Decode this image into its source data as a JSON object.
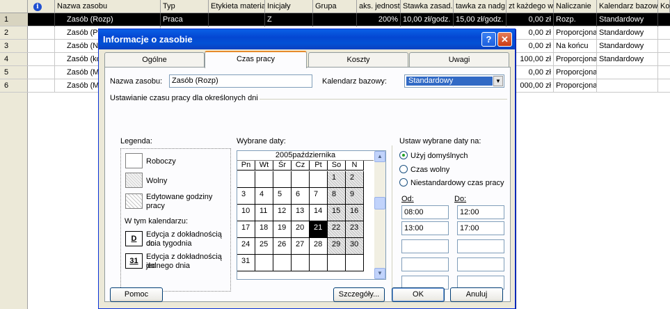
{
  "sheet": {
    "columns": [
      "",
      "",
      "Nazwa zasobu",
      "Typ",
      "Etykieta materia",
      "Inicjały",
      "Grupa",
      "aks. jednost",
      "Stawka zasad.",
      "tawka za nadg",
      "zt każdego w",
      "Naliczanie",
      "Kalendarz bazow",
      "Koo"
    ],
    "rows": [
      {
        "num": "1",
        "name": "Zasób (Rozp)",
        "type": "Praca",
        "initials": "Z",
        "units": "200%",
        "rate": "10,00 zł/godz.",
        "ovt": "15,00 zł/godz.",
        "cost": "0,00 zł",
        "accrue": "Rozp.",
        "calendar": "Standardowy"
      },
      {
        "num": "2",
        "name": "Zasób (Pr",
        "type": "",
        "initials": "",
        "units": "",
        "rate": "",
        "ovt": "",
        "cost": "0,00 zł",
        "accrue": "Proporcjona",
        "calendar": "Standardowy"
      },
      {
        "num": "3",
        "name": "Zasób (N",
        "type": "",
        "initials": "",
        "units": "",
        "rate": "",
        "ovt": "",
        "cost": "0,00 zł",
        "accrue": "Na końcu",
        "calendar": "Standardowy"
      },
      {
        "num": "4",
        "name": "Zasób (ko",
        "type": "",
        "initials": "",
        "units": "",
        "rate": "",
        "ovt": "",
        "cost": "100,00 zł",
        "accrue": "Proporcjona",
        "calendar": "Standardowy"
      },
      {
        "num": "5",
        "name": "Zasób (M",
        "type": "",
        "initials": "",
        "units": "",
        "rate": "",
        "ovt": "",
        "cost": "0,00 zł",
        "accrue": "Proporcjona",
        "calendar": ""
      },
      {
        "num": "6",
        "name": "Zasób (M",
        "type": "",
        "initials": "",
        "units": "",
        "rate": "",
        "ovt": "",
        "cost": "000,00 zł",
        "accrue": "Proporcjona",
        "calendar": ""
      }
    ]
  },
  "dialog": {
    "title": "Informacje o zasobie",
    "help_glyph": "?",
    "close_glyph": "✕",
    "tabs": [
      "Ogólne",
      "Czas pracy",
      "Koszty",
      "Uwagi"
    ],
    "resource_name_label": "Nazwa zasobu:",
    "resource_name_value": "Zasób (Rozp)",
    "base_calendar_label": "Kalendarz bazowy:",
    "base_calendar_value": "Standardowy",
    "section_title": "Ustawianie czasu pracy dla określonych dni",
    "legend_title": "Legenda:",
    "legend": {
      "working": "Roboczy",
      "nonworking": "Wolny",
      "edited_1": "Edytowane godziny",
      "edited_2": "pracy",
      "in_calendar": "W tym kalendarzu:",
      "week_icon": "D",
      "week_1": "Edycja z dokładnością do",
      "week_2": "dnia tygodnia",
      "day_icon": "31",
      "day_1": "Edycja z dokładnością do",
      "day_2": "jednego dnia"
    },
    "selected_dates_label": "Wybrane daty:",
    "calendar": {
      "month_label": "2005października",
      "weekdays": [
        "Pn",
        "Wt",
        "Śr",
        "Cz",
        "Pt",
        "So",
        "N"
      ],
      "weeks": [
        [
          "",
          "",
          "",
          "",
          "",
          "1",
          "2"
        ],
        [
          "3",
          "4",
          "5",
          "6",
          "7",
          "8",
          "9"
        ],
        [
          "10",
          "11",
          "12",
          "13",
          "14",
          "15",
          "16"
        ],
        [
          "17",
          "18",
          "19",
          "20",
          "21",
          "22",
          "23"
        ],
        [
          "24",
          "25",
          "26",
          "27",
          "28",
          "29",
          "30"
        ],
        [
          "31",
          "",
          "",
          "",
          "",
          "",
          ""
        ]
      ],
      "selected_day": "21",
      "scroll_up": "▲",
      "scroll_down": "▼"
    },
    "set_dates_label": "Ustaw wybrane daty na:",
    "options": [
      {
        "label": "Użyj domyślnych",
        "checked": true
      },
      {
        "label": "Czas wolny",
        "checked": false
      },
      {
        "label": "Niestandardowy czas pracy",
        "checked": false
      }
    ],
    "from_label": "Od:",
    "to_label": "Do:",
    "times": [
      [
        "08:00",
        "12:00"
      ],
      [
        "13:00",
        "17:00"
      ],
      [
        "",
        ""
      ],
      [
        "",
        ""
      ],
      [
        "",
        ""
      ]
    ],
    "buttons": {
      "help": "Pomoc",
      "details": "Szczegóły...",
      "ok": "OK",
      "cancel": "Anuluj"
    }
  }
}
